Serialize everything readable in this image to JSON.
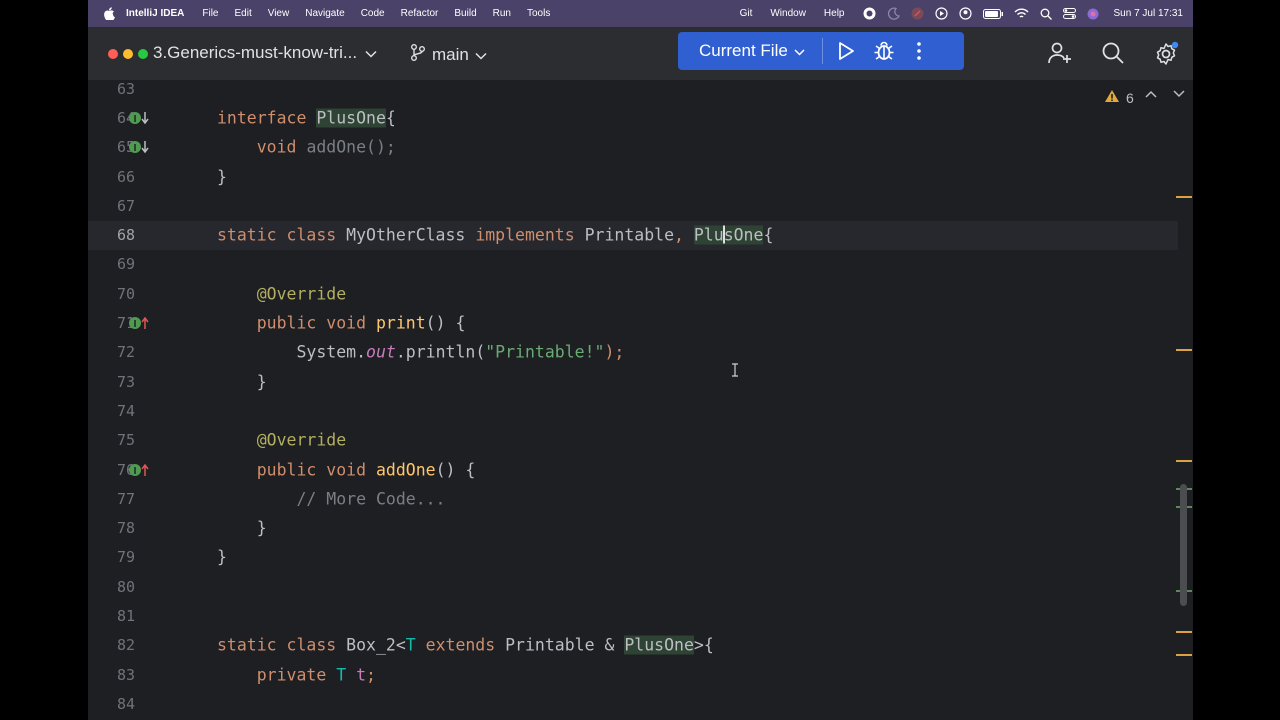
{
  "menubar": {
    "app_name": "IntelliJ IDEA",
    "menus": [
      "File",
      "Edit",
      "View",
      "Navigate",
      "Code",
      "Refactor",
      "Build",
      "Run",
      "Tools"
    ],
    "right_menus": [
      "Git",
      "Window",
      "Help"
    ],
    "clock": "Sun 7 Jul  17:31"
  },
  "toolbar": {
    "project_name": "3.Generics-must-know-tri...",
    "branch": "main",
    "run_config": "Current File"
  },
  "editor": {
    "warning_count": "6",
    "lines": [
      {
        "n": "63"
      },
      {
        "n": "64"
      },
      {
        "n": "65"
      },
      {
        "n": "66"
      },
      {
        "n": "67"
      },
      {
        "n": "68"
      },
      {
        "n": "69"
      },
      {
        "n": "70"
      },
      {
        "n": "71"
      },
      {
        "n": "72"
      },
      {
        "n": "73"
      },
      {
        "n": "74"
      },
      {
        "n": "75"
      },
      {
        "n": "76"
      },
      {
        "n": "77"
      },
      {
        "n": "78"
      },
      {
        "n": "79"
      },
      {
        "n": "80"
      },
      {
        "n": "81"
      },
      {
        "n": "82"
      },
      {
        "n": "83"
      },
      {
        "n": "84"
      }
    ],
    "code": {
      "l64": {
        "kw": "interface",
        "name": "PlusOne",
        "brace": "{"
      },
      "l65": {
        "kw": "void",
        "method": "addOne",
        "rest": "();"
      },
      "l66": {
        "text": "}"
      },
      "l68": {
        "kw1": "static",
        "kw2": "class",
        "name": "MyOtherClass",
        "kw3": "implements",
        "iface1": "Printable",
        "comma": ",",
        "iface2_a": "Plu",
        "iface2_b": "sOne",
        "brace": "{"
      },
      "l70": {
        "ann": "@Override"
      },
      "l71": {
        "kw1": "public",
        "kw2": "void",
        "method": "print",
        "rest": "() {"
      },
      "l72": {
        "cls": "System.",
        "field": "out",
        "call": ".println(",
        "str": "\"Printable!\"",
        "end": ");"
      },
      "l73": {
        "text": "}"
      },
      "l75": {
        "ann": "@Override"
      },
      "l76": {
        "kw1": "public",
        "kw2": "void",
        "method": "addOne",
        "rest": "() {"
      },
      "l77": {
        "comment": "// More Code..."
      },
      "l78": {
        "text": "}"
      },
      "l79": {
        "text": "}"
      },
      "l82": {
        "kw1": "static",
        "kw2": "class",
        "name": "Box_2<",
        "tp": "T",
        "kw3": "extends",
        "iface1": "Printable & ",
        "iface2": "PlusOne",
        "end": ">{"
      },
      "l83": {
        "kw": "private",
        "tp": "T",
        "field": "t",
        "end": ";"
      }
    }
  },
  "colors": {
    "menubar_bg": "#4a4268",
    "toolbar_bg": "#2b2d30",
    "editor_bg": "#1e1f22",
    "run_button_bg": "#2f5fd0",
    "keyword": "#cf8e6d",
    "annotation": "#b3ae60",
    "string": "#6aab73",
    "method_decl": "#56a8f5"
  },
  "icons": {
    "gutter_implemented": "interface-implemented-icon",
    "gutter_overrides": "overrides-method-icon"
  }
}
